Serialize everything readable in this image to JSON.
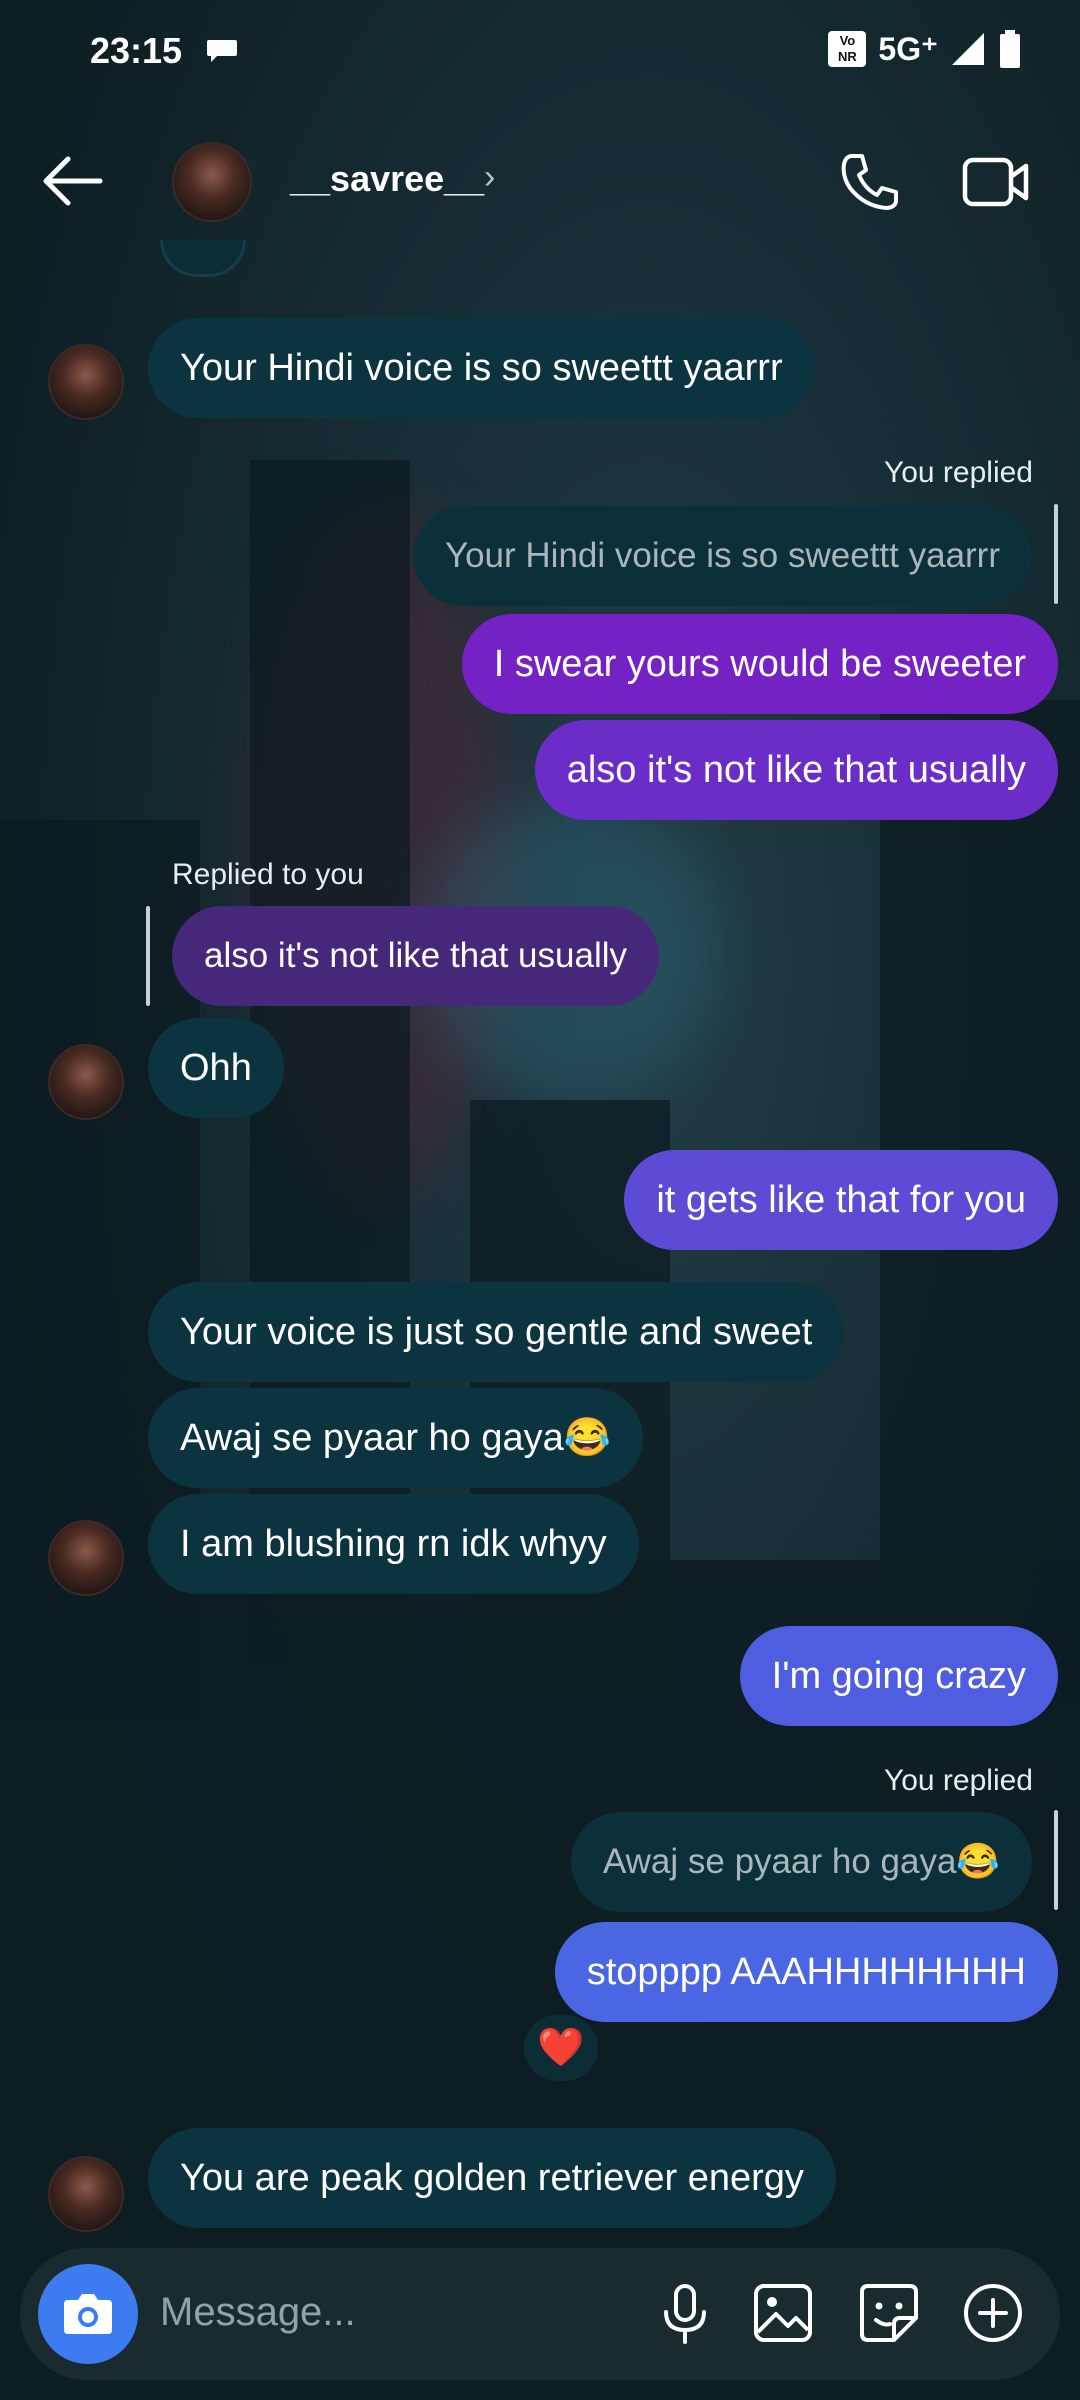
{
  "status_bar": {
    "time": "23:15",
    "vonr": [
      "Vo",
      "NR"
    ],
    "network": "5G⁺"
  },
  "header": {
    "username": "__savree__"
  },
  "messages": {
    "m1": "Your Hindi voice is so sweettt yaarrr",
    "you_replied_1": "You replied",
    "q1": "Your Hindi voice is so sweettt yaarrr",
    "m2": "I swear yours would be sweeter",
    "m3": "also it's not like that usually",
    "replied_to_you": "Replied to you",
    "q2": "also it's not like that usually",
    "m4": "Ohh",
    "m5": "it gets like that for you",
    "m6": "Your voice is just so gentle and sweet",
    "m7": "Awaj se pyaar ho gaya😂",
    "m8": "I am blushing rn idk whyy",
    "m9": "I'm going crazy",
    "you_replied_2": "You replied",
    "q3": "Awaj se pyaar ho gaya😂",
    "m10": "stopppp AAAHHHHHHHH",
    "reaction": "❤️",
    "m11": "You are peak golden retriever energy"
  },
  "composer": {
    "placeholder": "Message..."
  },
  "colors": {
    "incoming_bubble": "#0c3440",
    "outgoing_purple": "#7422c4",
    "outgoing_violet": "#6b32c8",
    "outgoing_indigo": "#5a4fd6",
    "outgoing_blue": "#4d63e0",
    "camera_button": "#3c7cf0"
  },
  "icons": [
    "back-arrow-icon",
    "chevron-right-icon",
    "phone-icon",
    "video-camera-icon",
    "camera-icon",
    "microphone-icon",
    "gallery-icon",
    "sticker-icon",
    "plus-circle-icon"
  ]
}
